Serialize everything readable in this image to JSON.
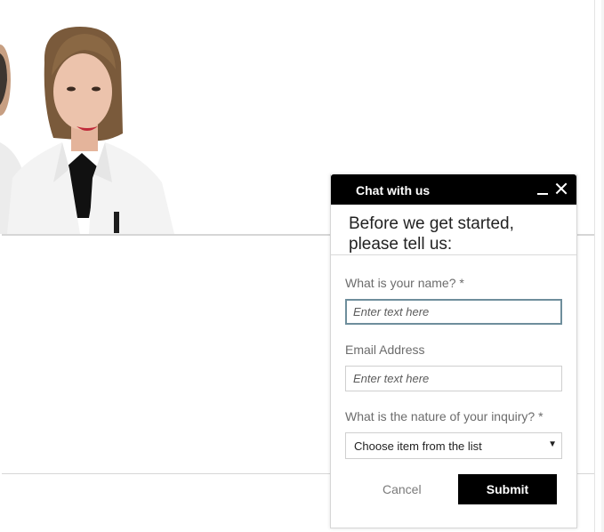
{
  "chat": {
    "title": "Chat with us",
    "intro_line1": "Before we get started,",
    "intro_line2": "please tell us:",
    "fields": {
      "name": {
        "label": "What is your name? *",
        "placeholder": "Enter text here"
      },
      "email": {
        "label": "Email Address",
        "placeholder": "Enter text here"
      },
      "inquiry": {
        "label": "What is the nature of your inquiry? *",
        "selected": "Choose item from the list"
      }
    },
    "cancel_label": "Cancel",
    "submit_label": "Submit"
  },
  "colors": {
    "header_bg": "#000000",
    "header_text": "#ffffff",
    "submit_bg": "#000000",
    "focus_border": "#6e8e9c"
  },
  "icons": [
    "minimize-icon",
    "close-icon",
    "dropdown-arrow-icon"
  ]
}
